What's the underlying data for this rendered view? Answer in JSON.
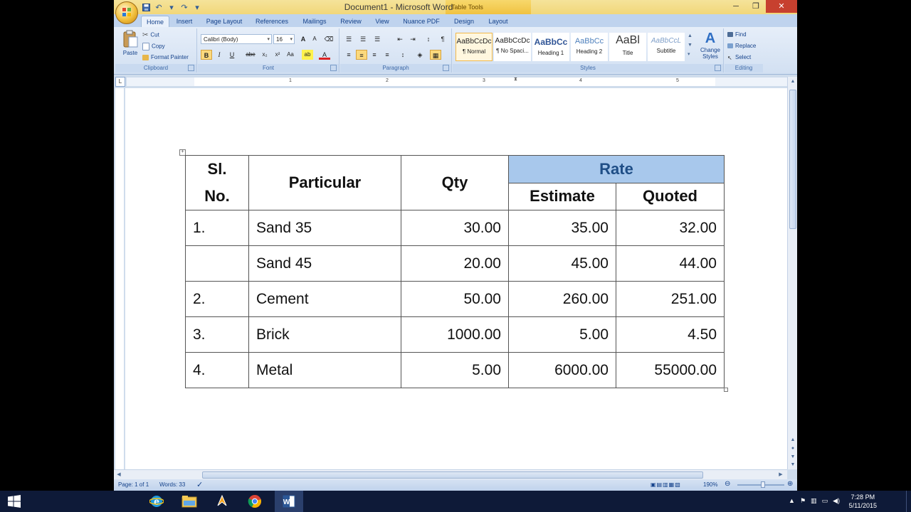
{
  "window": {
    "title": "Document1 - Microsoft Word",
    "context_group": "Table Tools",
    "controls": {
      "minimize": "─",
      "maximize": "❐",
      "close": "✕"
    }
  },
  "quick_access": {
    "save_icon": "save-icon",
    "undo_icon": "undo-icon",
    "redo_icon": "redo-icon",
    "customize_icon": "chevron-down-icon"
  },
  "tabs": [
    {
      "label": "Home",
      "active": true
    },
    {
      "label": "Insert"
    },
    {
      "label": "Page Layout"
    },
    {
      "label": "References"
    },
    {
      "label": "Mailings"
    },
    {
      "label": "Review"
    },
    {
      "label": "View"
    },
    {
      "label": "Nuance PDF"
    },
    {
      "label": "Design",
      "contextual": true
    },
    {
      "label": "Layout",
      "contextual": true
    }
  ],
  "ribbon": {
    "clipboard": {
      "label": "Clipboard",
      "paste": "Paste",
      "cut": "Cut",
      "copy": "Copy",
      "format_painter": "Format Painter"
    },
    "font": {
      "label": "Font",
      "font_name": "Calibri (Body)",
      "font_size": "16",
      "grow": "A",
      "shrink": "A",
      "bold": "B",
      "italic": "I",
      "underline": "U",
      "strike": "abe",
      "subscript": "x₂",
      "superscript": "x²",
      "change_case": "Aa",
      "highlight": "ab",
      "font_color": "A"
    },
    "paragraph": {
      "label": "Paragraph",
      "show_marks": "¶"
    },
    "styles": {
      "label": "Styles",
      "tiles": [
        {
          "sample": "AaBbCcDc",
          "name": "¶ Normal",
          "selected": true
        },
        {
          "sample": "AaBbCcDc",
          "name": "¶ No Spaci..."
        },
        {
          "sample": "AaBbCc",
          "name": "Heading 1"
        },
        {
          "sample": "AaBbCc",
          "name": "Heading 2"
        },
        {
          "sample": "AaBl",
          "name": "Title"
        },
        {
          "sample": "AaBbCcL",
          "name": "Subtitle"
        }
      ],
      "change_styles": "Change Styles"
    },
    "editing": {
      "label": "Editing",
      "find": "Find",
      "replace": "Replace",
      "select": "Select"
    }
  },
  "ruler": {
    "corner": "L",
    "numbers": [
      "1",
      "2",
      "3",
      "4",
      "5"
    ]
  },
  "table": {
    "headers": {
      "sl": "Sl. No.",
      "particular": "Particular",
      "qty": "Qty",
      "rate": "Rate",
      "estimate": "Estimate",
      "quoted": "Quoted"
    },
    "rows": [
      {
        "sl": "1.",
        "particular": "Sand 35",
        "qty": "30.00",
        "estimate": "35.00",
        "quoted": "32.00"
      },
      {
        "sl": "",
        "particular": "Sand 45",
        "qty": "20.00",
        "estimate": "45.00",
        "quoted": "44.00"
      },
      {
        "sl": "2.",
        "particular": "Cement",
        "qty": "50.00",
        "estimate": "260.00",
        "quoted": "251.00"
      },
      {
        "sl": "3.",
        "particular": "Brick",
        "qty": "1000.00",
        "estimate": "5.00",
        "quoted": "4.50"
      },
      {
        "sl": "4.",
        "particular": "Metal",
        "qty": "5.00",
        "estimate": "6000.00",
        "quoted": "55000.00"
      }
    ],
    "colors": {
      "rate_header_bg": "#a8c8ec",
      "rate_header_text": "#1f4e86"
    }
  },
  "statusbar": {
    "page": "Page: 1 of 1",
    "words": "Words: 33",
    "zoom": "190%"
  },
  "taskbar": {
    "clock_time": "7:28 PM",
    "clock_date": "5/11/2015",
    "apps": [
      "windows-start-icon",
      "internet-explorer-icon",
      "file-explorer-icon",
      "winamp-icon",
      "chrome-icon",
      "word-icon"
    ]
  }
}
